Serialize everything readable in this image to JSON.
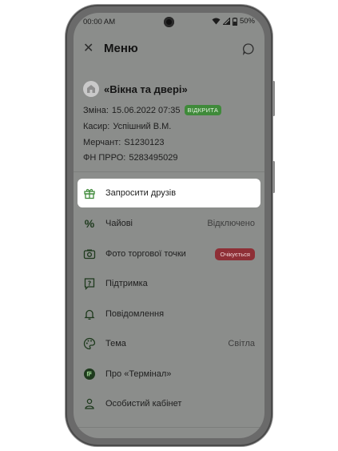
{
  "status": {
    "time": "00:00 AM",
    "battery": "50%"
  },
  "header": {
    "title": "Меню"
  },
  "store": {
    "name": "«Вікна та двері»",
    "shift_label": "Зміна:",
    "shift_value": "15.06.2022 07:35",
    "shift_badge": "ВІДКРИТА",
    "cashier_label": "Касир:",
    "cashier_value": "Успішний В.М.",
    "merchant_label": "Мерчант:",
    "merchant_value": "S1230123",
    "fn_label": "ФН ПРРО:",
    "fn_value": "5283495029"
  },
  "menu": {
    "invite": "Запросити друзів",
    "tips": "Чайові",
    "tips_value": "Відключено",
    "photo": "Фото торгової точки",
    "photo_badge": "Очікується",
    "support": "Підтримка",
    "notifications": "Повідомлення",
    "theme": "Тема",
    "theme_value": "Світла",
    "about": "Про «Термінал»",
    "cabinet": "Особистий кабінет"
  },
  "colors": {
    "accent": "#3f8a3a",
    "badge_wait": "#8e2f36",
    "overlay": "#8b8d8b"
  }
}
